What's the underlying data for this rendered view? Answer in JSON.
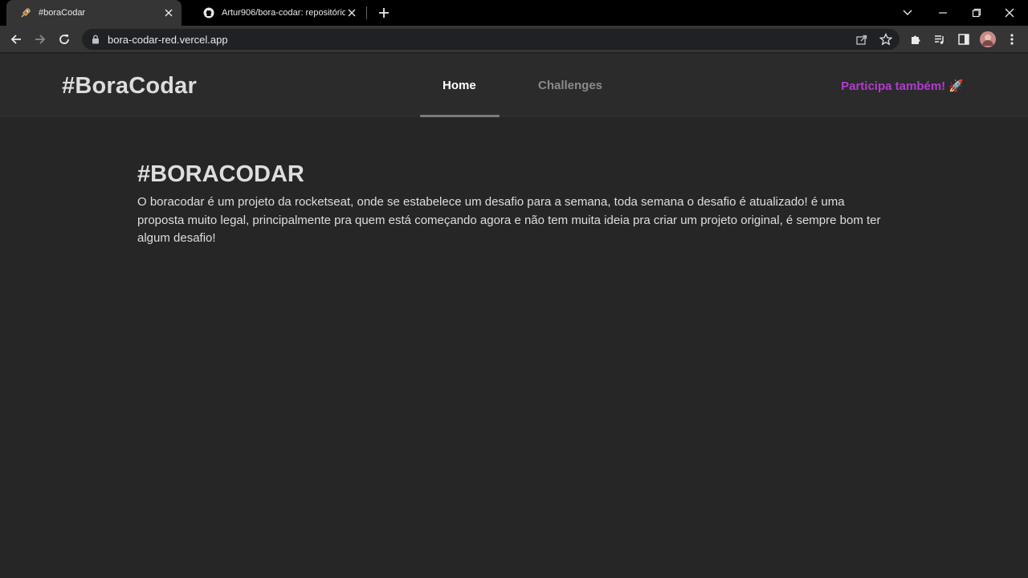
{
  "browser": {
    "tabs": [
      {
        "title": "#boraCodar",
        "favicon": "rocket-icon",
        "active": true
      },
      {
        "title": "Artur906/bora-codar: repositório",
        "favicon": "github-icon",
        "active": false
      }
    ],
    "url": "bora-codar-red.vercel.app"
  },
  "site": {
    "logo": "#BoraCodar",
    "nav": [
      {
        "label": "Home",
        "active": true
      },
      {
        "label": "Challenges",
        "active": false
      }
    ],
    "cta": "Participa também! 🚀",
    "hero": {
      "title": "#BORACODAR",
      "text": "O boracodar é um projeto da rocketseat, onde se estabelece um desafio para a semana, toda semana o desafio é atualizado! é uma proposta muito legal, principalmente pra quem está começando agora e não tem muita ideia pra criar um projeto original, é sempre bom ter algum desafio!"
    }
  },
  "colors": {
    "accent": "#b23bd1",
    "background": "#262626",
    "header": "#2b2b2b"
  }
}
